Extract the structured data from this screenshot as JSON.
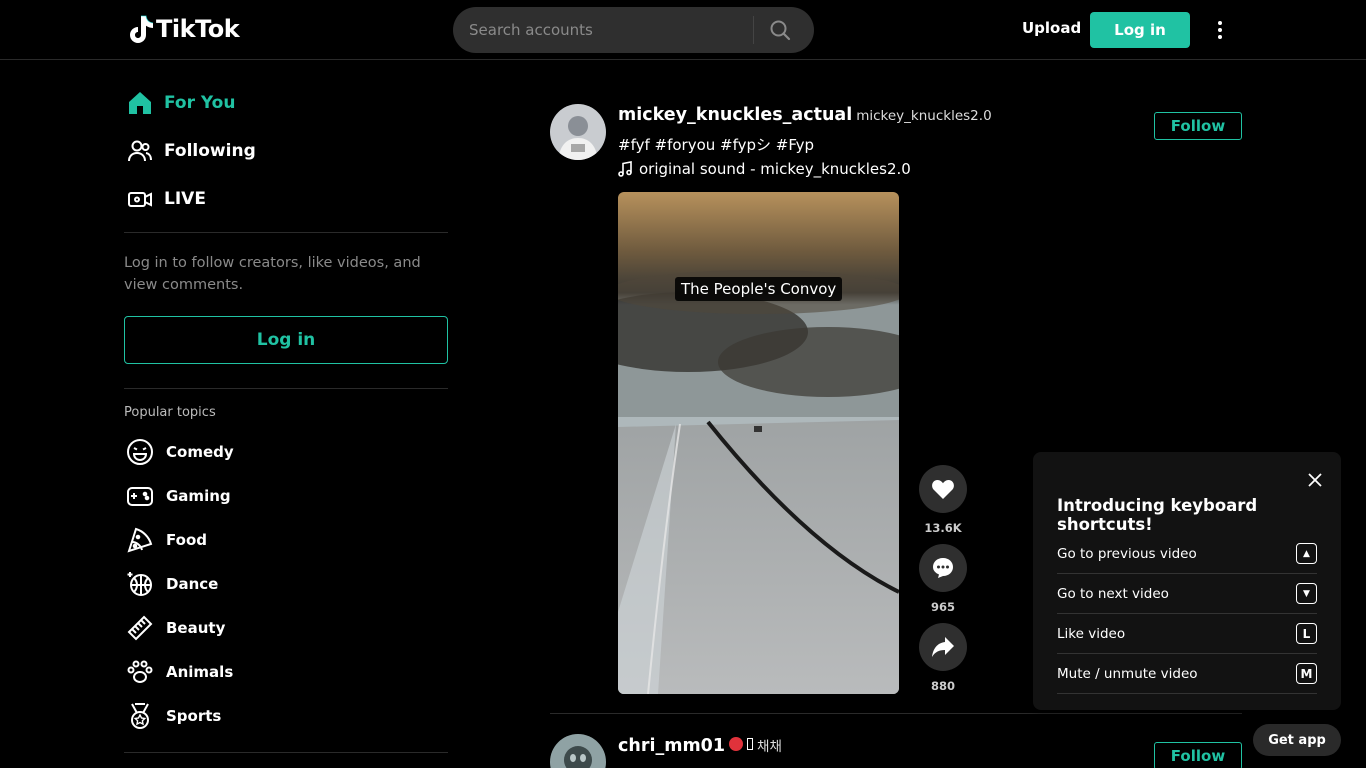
{
  "header": {
    "logo_text": "TikTok",
    "search_placeholder": "Search accounts",
    "upload_label": "Upload",
    "login_label": "Log in"
  },
  "sidebar": {
    "nav": [
      {
        "label": "For You",
        "icon": "home-icon",
        "active": true
      },
      {
        "label": "Following",
        "icon": "users-icon",
        "active": false
      },
      {
        "label": "LIVE",
        "icon": "live-icon",
        "active": false
      }
    ],
    "login_message": "Log in to follow creators, like videos, and view comments.",
    "login_label": "Log in",
    "topics_title": "Popular topics",
    "topics": [
      {
        "label": "Comedy",
        "icon": "smile-icon"
      },
      {
        "label": "Gaming",
        "icon": "gamepad-icon"
      },
      {
        "label": "Food",
        "icon": "pizza-icon"
      },
      {
        "label": "Dance",
        "icon": "disco-ball-icon"
      },
      {
        "label": "Beauty",
        "icon": "comb-icon"
      },
      {
        "label": "Animals",
        "icon": "paw-icon"
      },
      {
        "label": "Sports",
        "icon": "medal-icon"
      }
    ]
  },
  "feed": {
    "posts": [
      {
        "username": "mickey_knuckles_actual",
        "nickname": "mickey_knuckles2.0",
        "caption": "#fyf #foryou #fypシ #Fyp",
        "sound": "original sound - mickey_knuckles2.0",
        "follow_label": "Follow",
        "video_caption": "The People's Convoy",
        "likes": "13.6K",
        "comments": "965",
        "shares": "880"
      },
      {
        "username": "chri_mm01",
        "nickname": "채채",
        "follow_label": "Follow"
      }
    ]
  },
  "shortcuts": {
    "title": "Introducing keyboard shortcuts!",
    "items": [
      {
        "label": "Go to previous video",
        "key": "▲"
      },
      {
        "label": "Go to next video",
        "key": "▼"
      },
      {
        "label": "Like video",
        "key": "L"
      },
      {
        "label": "Mute / unmute video",
        "key": "M"
      }
    ]
  },
  "get_app_label": "Get app",
  "colors": {
    "accent": "#20c2a3",
    "background": "#000000",
    "surface": "#2f2f2f"
  }
}
